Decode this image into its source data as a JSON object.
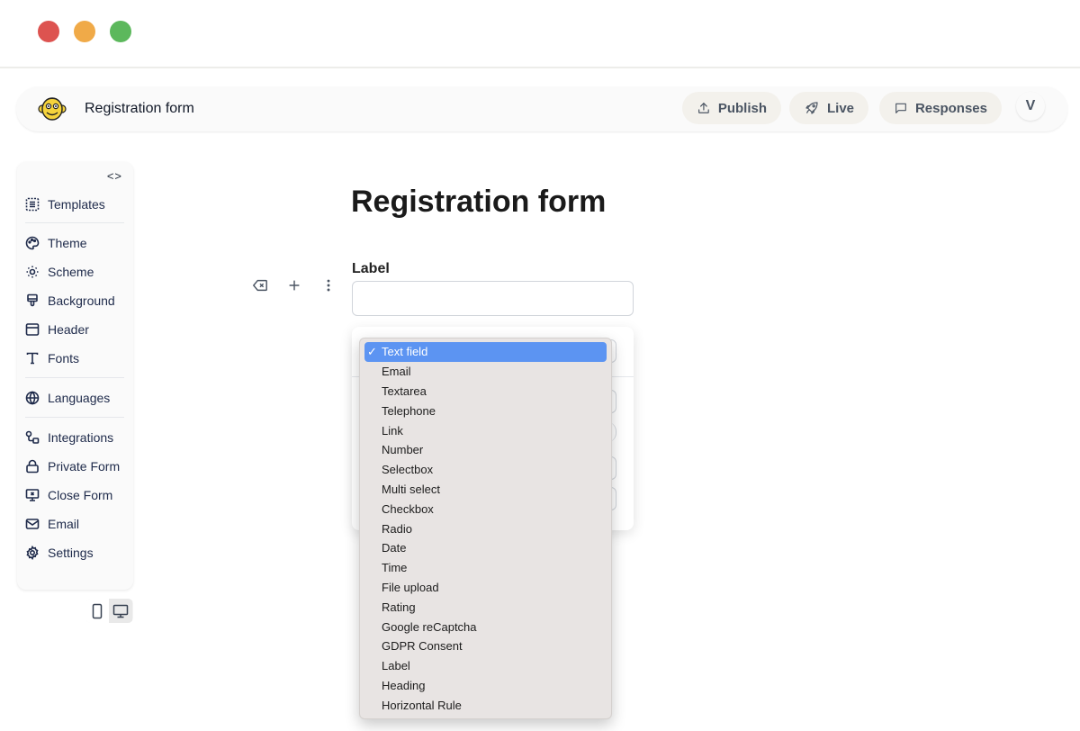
{
  "window": {
    "controls": [
      "close",
      "minimize",
      "maximize"
    ]
  },
  "topbar": {
    "logo_icon": "monkey-face-logo",
    "title": "Registration form",
    "buttons": [
      {
        "label": "Publish",
        "icon": "upload-icon"
      },
      {
        "label": "Live",
        "icon": "rocket-icon"
      },
      {
        "label": "Responses",
        "icon": "message-square-icon"
      }
    ],
    "avatar_initial": "V"
  },
  "sidebar": {
    "collapse_label": "<>",
    "items": [
      {
        "label": "Templates",
        "icon": "templates-icon"
      },
      {
        "label": "Theme",
        "icon": "palette-icon"
      },
      {
        "label": "Scheme",
        "icon": "sun-icon"
      },
      {
        "label": "Background",
        "icon": "paintbrush-icon"
      },
      {
        "label": "Header",
        "icon": "layout-header-icon"
      },
      {
        "label": "Fonts",
        "icon": "type-icon"
      },
      {
        "label": "Languages",
        "icon": "globe-icon"
      },
      {
        "label": "Integrations",
        "icon": "integrations-icon"
      },
      {
        "label": "Private Form",
        "icon": "lock-icon"
      },
      {
        "label": "Close Form",
        "icon": "monitor-x-icon"
      },
      {
        "label": "Email",
        "icon": "mail-icon"
      },
      {
        "label": "Settings",
        "icon": "gear-icon"
      }
    ],
    "device_toggle": {
      "options": [
        "mobile",
        "desktop"
      ],
      "active": "desktop"
    }
  },
  "form": {
    "title": "Registration form",
    "field_label": "Label",
    "field_value": "",
    "row_tools": [
      "delete-icon",
      "add-icon",
      "more-vertical-icon"
    ]
  },
  "field_type_dropdown": {
    "selected": "Text field",
    "check_mark": "✓",
    "options": [
      "Text field",
      "Email",
      "Textarea",
      "Telephone",
      "Link",
      "Number",
      "Selectbox",
      "Multi select",
      "Checkbox",
      "Radio",
      "Date",
      "Time",
      "File upload",
      "Rating",
      "Google reCaptcha",
      "GDPR Consent",
      "Label",
      "Heading",
      "Horizontal Rule"
    ]
  }
}
